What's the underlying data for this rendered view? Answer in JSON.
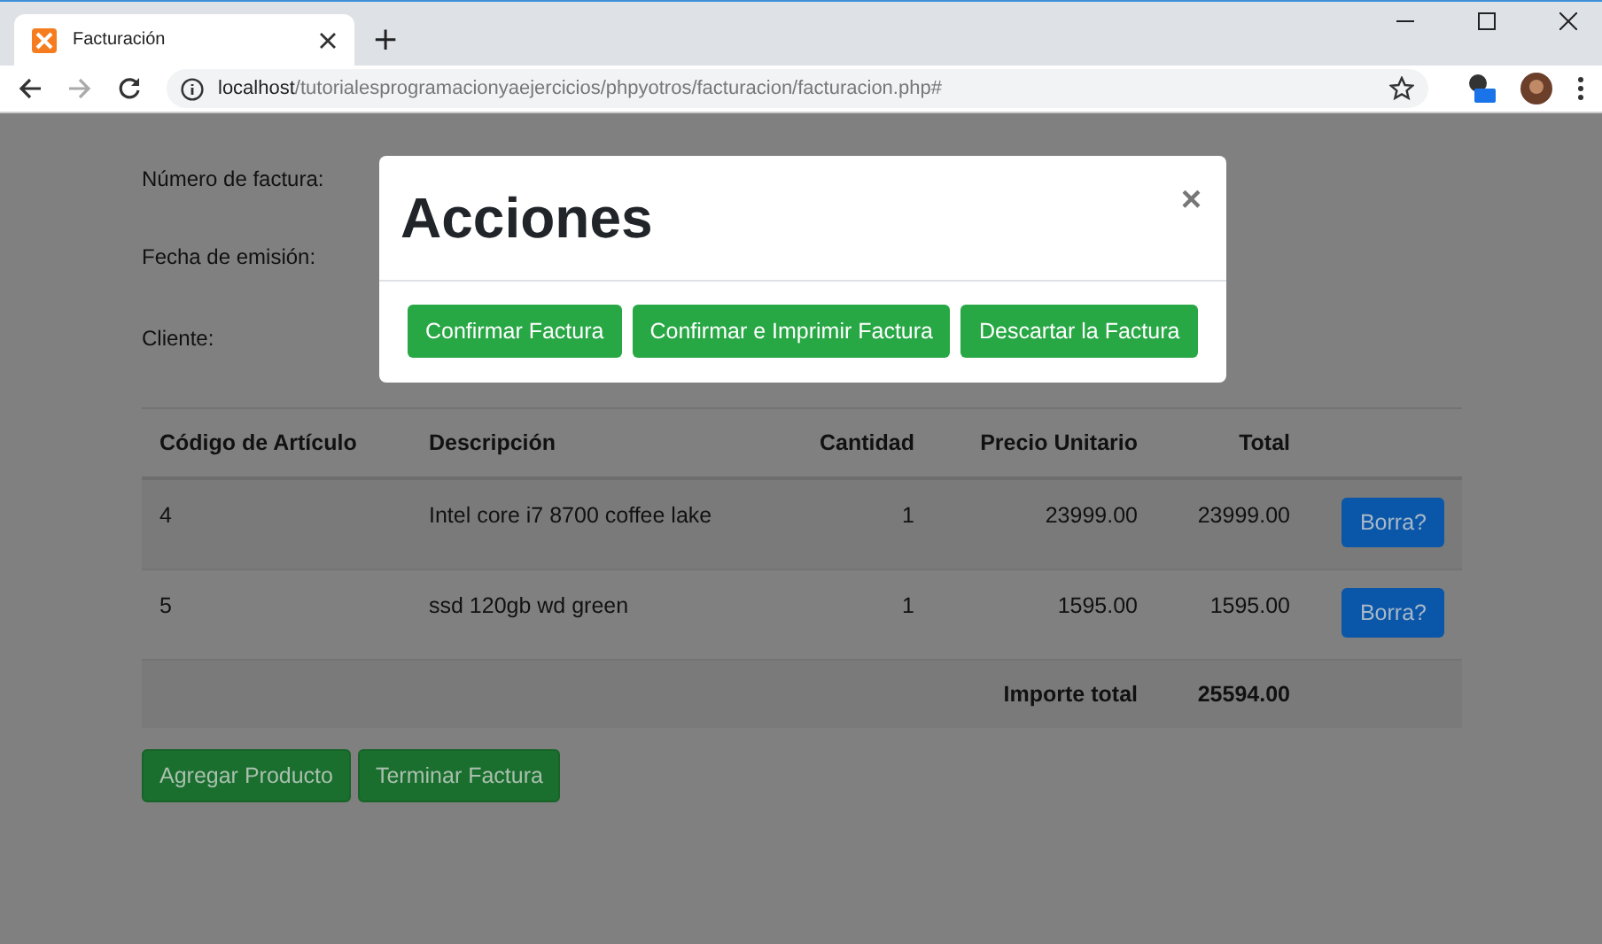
{
  "browser": {
    "tab_title": "Facturación",
    "new_tab": "+",
    "url_host": "localhost",
    "url_path": "/tutorialesprogramacionyaejercicios/phpyotros/facturacion/facturacion.php#"
  },
  "form": {
    "labels": [
      "Número de factura:",
      "Fecha de emisión:",
      "Cliente:"
    ]
  },
  "table": {
    "columns": [
      "Código de Artículo",
      "Descripción",
      "Cantidad",
      "Precio Unitario",
      "Total"
    ],
    "rows": [
      {
        "cells": [
          "4",
          "Intel core i7 8700 coffee lake",
          "1",
          "23999.00",
          "23999.00"
        ],
        "action": "Borra?"
      },
      {
        "cells": [
          "5",
          "ssd 120gb wd green",
          "1",
          "1595.00",
          "1595.00"
        ],
        "action": "Borra?"
      }
    ],
    "total_label": "Importe total",
    "total_value": "25594.00"
  },
  "page_buttons": [
    "Agregar Producto",
    "Terminar Factura"
  ],
  "modal": {
    "title": "Acciones",
    "close": "×",
    "buttons": [
      "Confirmar Factura",
      "Confirmar e Imprimir Factura",
      "Descartar la Factura"
    ]
  }
}
